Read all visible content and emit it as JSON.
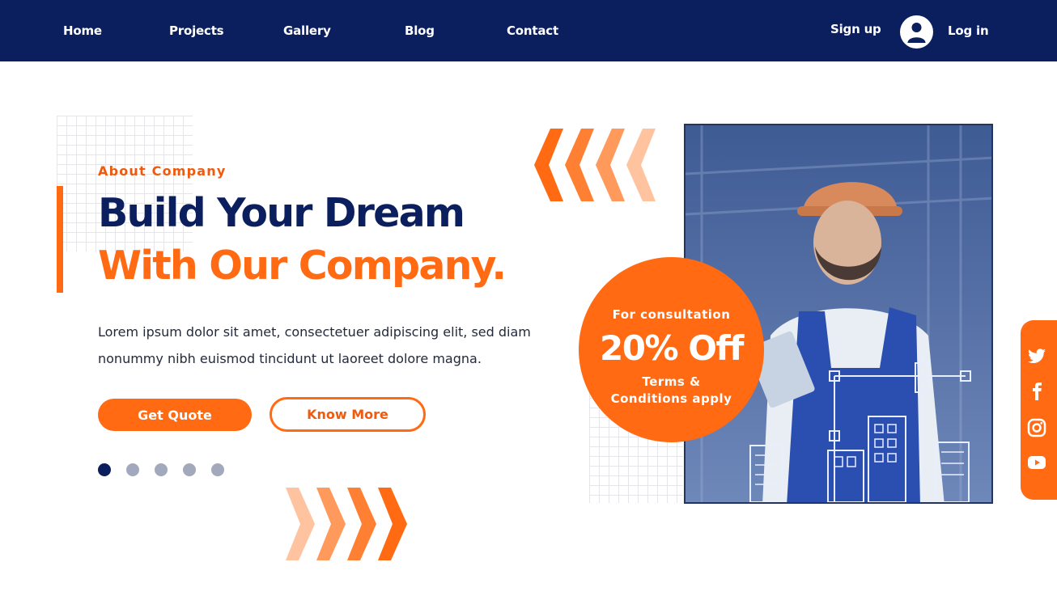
{
  "nav": {
    "links": [
      "Home",
      "Projects",
      "Gallery",
      "Blog",
      "Contact"
    ],
    "signup_label": "Sign up",
    "login_label": "Log in",
    "user_icon": "user-avatar-icon"
  },
  "hero": {
    "eyebrow": "About Company",
    "headline_line1": "Build Your Dream",
    "headline_line2": "With Our Company.",
    "body_line1": "Lorem ipsum dolor sit amet, consectetuer adipiscing elit, sed diam",
    "body_line2": "nonummy nibh euismod tincidunt ut laoreet dolore magna.",
    "primary_button": "Get Quote",
    "secondary_button": "Know More",
    "slider": {
      "count": 5,
      "active_index": 0
    }
  },
  "promo": {
    "top_text": "For consultation",
    "big_text": "20% Off",
    "small_text": "Terms & Conditions apply"
  },
  "social": {
    "icons": [
      "twitter-icon",
      "facebook-icon",
      "instagram-icon",
      "youtube-icon"
    ]
  },
  "colors": {
    "navy": "#0b1f5e",
    "orange": "#ff6a13",
    "light_orange": "#ffb084",
    "dot_inactive": "#a3a9bd",
    "white": "#ffffff"
  }
}
